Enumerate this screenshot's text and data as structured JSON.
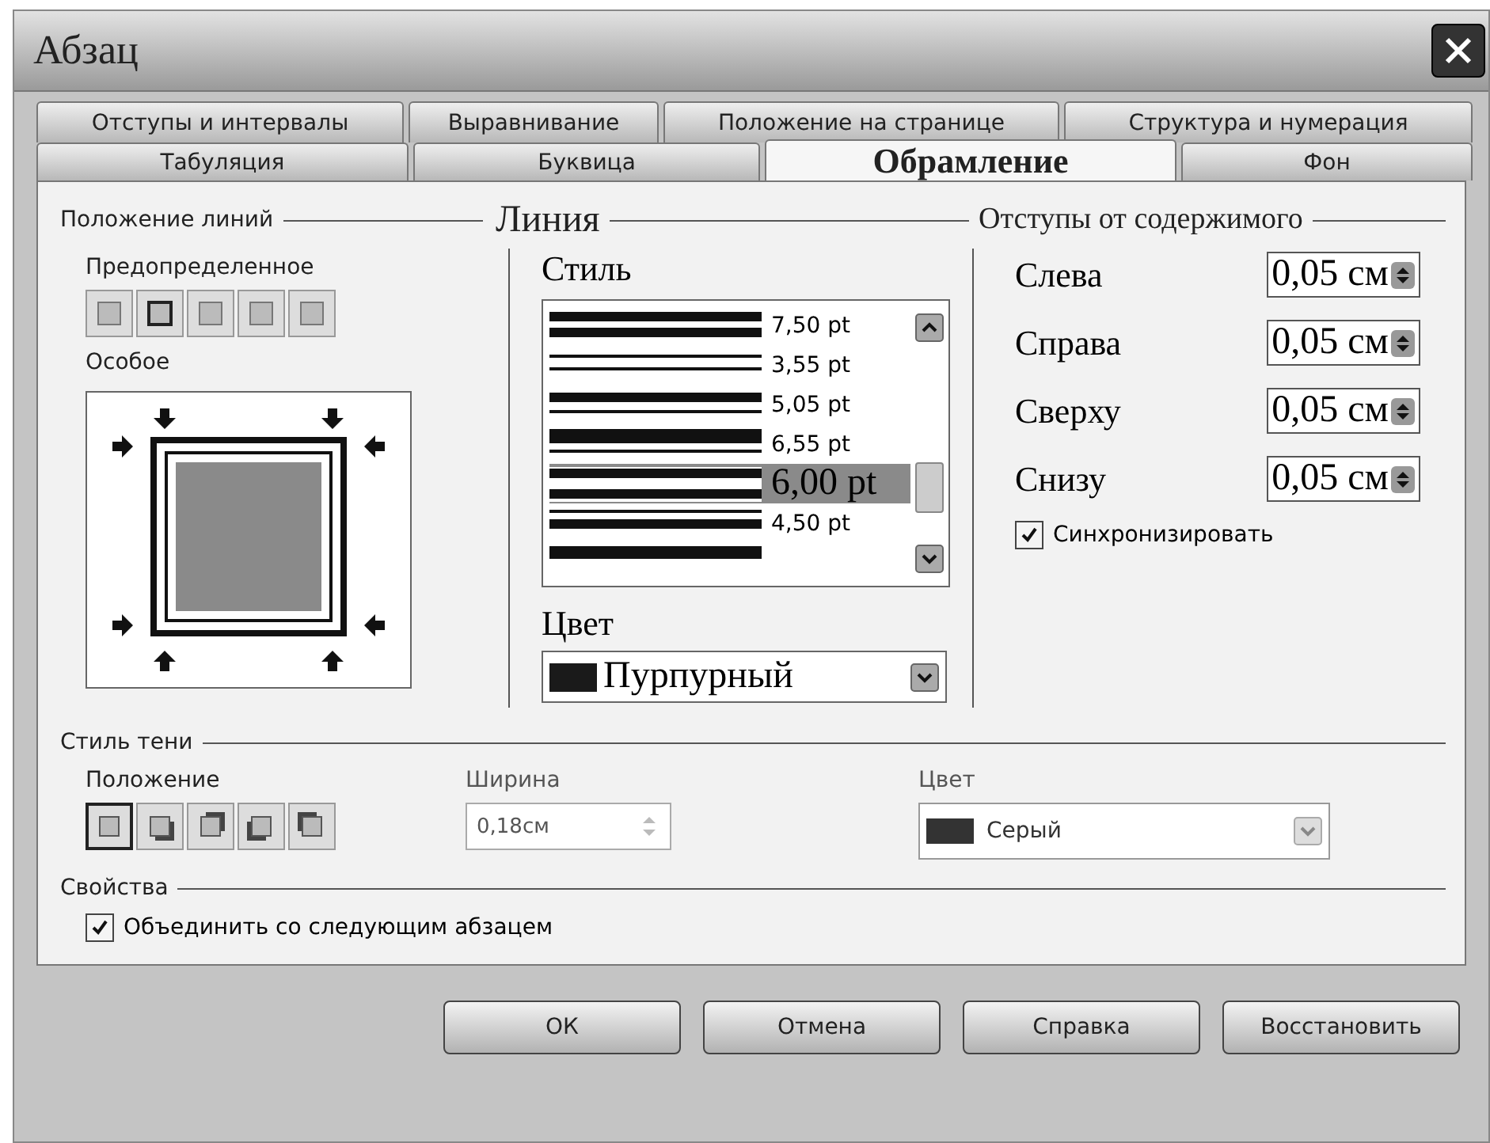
{
  "window": {
    "title": "Абзац"
  },
  "tab_rows": [
    [
      {
        "label": "Отступы и интервалы",
        "selected": false
      },
      {
        "label": "Выравнивание",
        "selected": false
      },
      {
        "label": "Положение на странице",
        "selected": false
      },
      {
        "label": "Структура и нумерация",
        "selected": false
      }
    ],
    [
      {
        "label": "Табуляция",
        "selected": false
      },
      {
        "label": "Буквица",
        "selected": false
      },
      {
        "label": "Обрамление",
        "selected": true
      },
      {
        "label": "Фон",
        "selected": false
      }
    ]
  ],
  "line_position": {
    "title": "Положение линий",
    "predefined_label": "Предопределенное",
    "custom_label": "Особое"
  },
  "line": {
    "title": "Линия",
    "style_label": "Стиль",
    "styles": [
      {
        "kind": "equal",
        "label": "7,50 pt",
        "selected": false
      },
      {
        "kind": "thin",
        "label": "3,55 pt",
        "selected": false
      },
      {
        "kind": "thick-thin",
        "label": "5,05 pt",
        "selected": false
      },
      {
        "kind": "thicker-thin",
        "label": "6,55 pt",
        "selected": false
      },
      {
        "kind": "equal-gap",
        "label": "6,00 pt",
        "selected": true
      },
      {
        "kind": "thin-thick",
        "label": "4,50 pt",
        "selected": false
      }
    ],
    "color_label": "Цвет",
    "color_value": "Пурпурный"
  },
  "padding": {
    "title": "Отступы от содержимого",
    "fields": [
      {
        "label": "Слева",
        "value": "0,05 см"
      },
      {
        "label": "Справа",
        "value": "0,05 см"
      },
      {
        "label": "Сверху",
        "value": "0,05 см"
      },
      {
        "label": "Снизу",
        "value": "0,05 см"
      }
    ],
    "sync": {
      "label": "Синхронизировать",
      "checked": true
    }
  },
  "shadow": {
    "title": "Стиль тени",
    "position_label": "Положение",
    "positions": [
      {
        "kind": "none",
        "selected": true
      },
      {
        "kind": "bottom-right",
        "selected": false
      },
      {
        "kind": "top-right",
        "selected": false
      },
      {
        "kind": "bottom-left",
        "selected": false
      },
      {
        "kind": "top-left",
        "selected": false
      }
    ],
    "width_label": "Ширина",
    "width_value": "0,18см",
    "color_label": "Цвет",
    "color_value": "Серый"
  },
  "properties": {
    "title": "Свойства",
    "merge": {
      "label": "Объединить со следующим абзацем",
      "checked": true
    }
  },
  "buttons": [
    "ОК",
    "Отмена",
    "Справка",
    "Восстановить"
  ]
}
